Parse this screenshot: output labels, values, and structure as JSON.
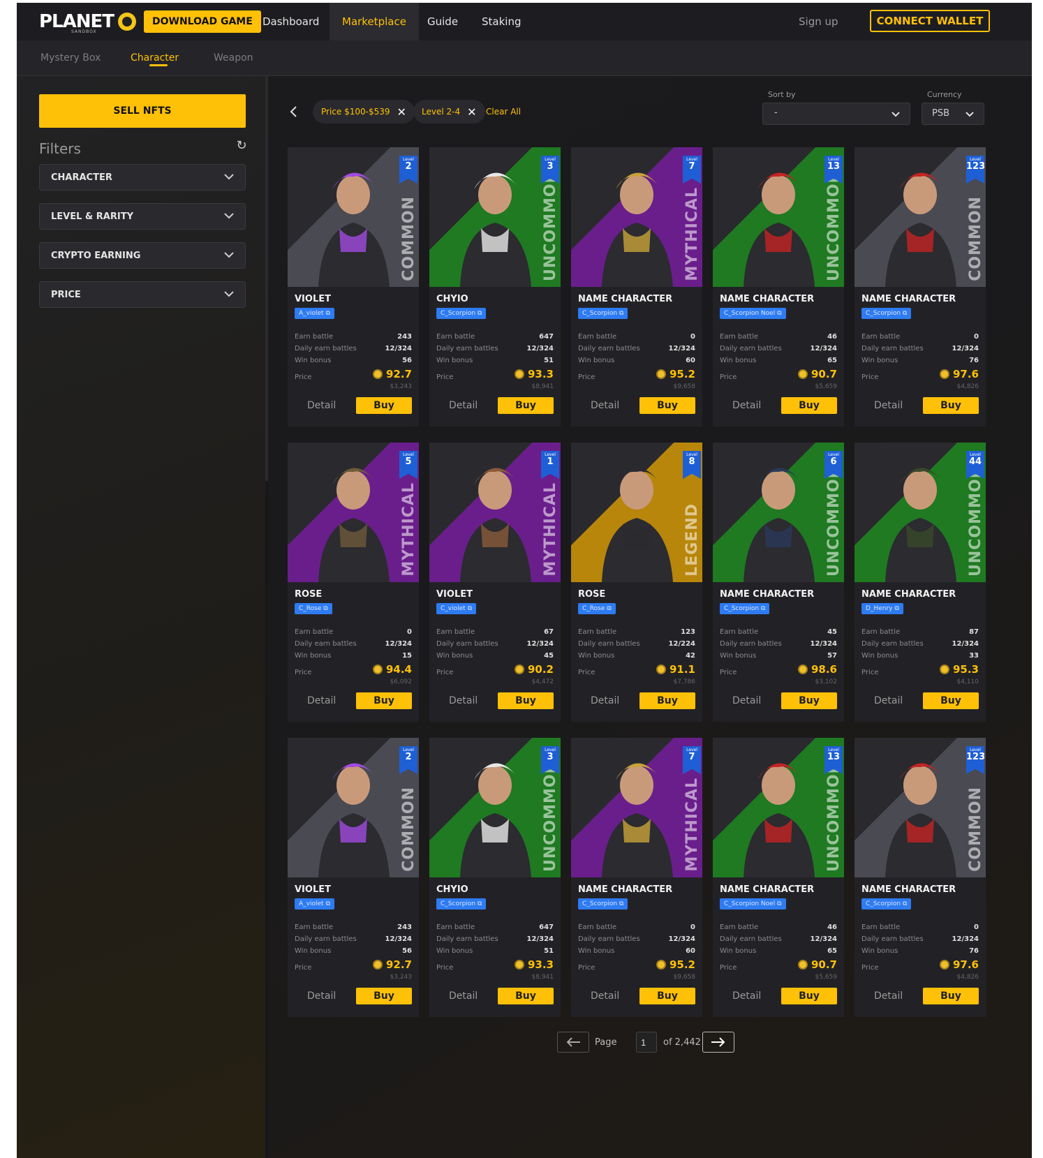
{
  "header": {
    "logo": "PLANET",
    "logo_sub": "SANDBOX",
    "download_label": "DOWNLOAD GAME",
    "nav": [
      "Dashboard",
      "Marketplace",
      "Guide",
      "Staking"
    ],
    "signup_label": "Sign up",
    "connect_label": "CONNECT WALLET"
  },
  "subnav": [
    "Mystery Box",
    "Character",
    "Weapon"
  ],
  "sidebar": {
    "sell_label": "SELL NFTS",
    "filters_title": "Filters",
    "filters": [
      "CHARACTER",
      "LEVEL & RARITY",
      "CRYPTO EARNING",
      "PRICE"
    ]
  },
  "toolbar": {
    "chips": [
      "Price $100-$539",
      "Level 2-4"
    ],
    "clear_all": "Clear All",
    "sort_label": "Sort by",
    "sort_value": "-",
    "currency_label": "Currency",
    "currency_value": "PSB"
  },
  "card_labels": {
    "earn": "Earn battle",
    "daily": "Daily earn battles",
    "win": "Win bonus",
    "price": "Price",
    "detail": "Detail",
    "buy": "Buy",
    "level": "Level"
  },
  "cards": [
    {
      "name": "VIOLET",
      "tag": "A_violet",
      "level": "2",
      "rarity": "COMMON",
      "earn": "243",
      "daily": "12/324",
      "win": "56",
      "price": "92.7",
      "usd": "$3,243",
      "bg": "#4a4a52",
      "accent": "#a14be0"
    },
    {
      "name": "CHYIO",
      "tag": "C_Scorpion",
      "level": "3",
      "rarity": "UNCOMMON",
      "earn": "647",
      "daily": "12/324",
      "win": "51",
      "price": "93.3",
      "usd": "$8,941",
      "bg": "#1f7a22",
      "accent": "#e8e8e8"
    },
    {
      "name": "NAME CHARACTER",
      "tag": "C_Scorpion",
      "level": "7",
      "rarity": "MYTHICAL",
      "earn": "0",
      "daily": "12/324",
      "win": "60",
      "price": "95.2",
      "usd": "$9,658",
      "bg": "#6a1e8c",
      "accent": "#c8a23a"
    },
    {
      "name": "NAME CHARACTER",
      "tag": "C_Scorpion Noel",
      "level": "13",
      "rarity": "UNCOMMON",
      "earn": "46",
      "daily": "12/324",
      "win": "65",
      "price": "90.7",
      "usd": "$5,659",
      "bg": "#1f7a22",
      "accent": "#c42323"
    },
    {
      "name": "NAME CHARACTER",
      "tag": "C_Scorpion",
      "level": "123",
      "rarity": "COMMON",
      "earn": "0",
      "daily": "12/324",
      "win": "76",
      "price": "97.6",
      "usd": "$4,826",
      "bg": "#4a4a52",
      "accent": "#c42323"
    },
    {
      "name": "ROSE",
      "tag": "C_Rose",
      "level": "5",
      "rarity": "MYTHICAL",
      "earn": "0",
      "daily": "12/324",
      "win": "15",
      "price": "94.4",
      "usd": "$6,092",
      "bg": "#6a1e8c",
      "accent": "#6e5a3a"
    },
    {
      "name": "VIOLET",
      "tag": "C_violet",
      "level": "1",
      "rarity": "MYTHICAL",
      "earn": "67",
      "daily": "12/324",
      "win": "45",
      "price": "90.2",
      "usd": "$4,472",
      "bg": "#6a1e8c",
      "accent": "#8a5a3a"
    },
    {
      "name": "ROSE",
      "tag": "C_Rose",
      "level": "8",
      "rarity": "LEGEND",
      "earn": "123",
      "daily": "12/224",
      "win": "42",
      "price": "91.1",
      "usd": "$7,786",
      "bg": "#b8860b",
      "accent": "#2a2a30"
    },
    {
      "name": "NAME CHARACTER",
      "tag": "C_Scorpion",
      "level": "6",
      "rarity": "UNCOMMON",
      "earn": "45",
      "daily": "12/324",
      "win": "57",
      "price": "98.6",
      "usd": "$3,102",
      "bg": "#1f7a22",
      "accent": "#2a3a5a"
    },
    {
      "name": "NAME CHARACTER",
      "tag": "D_Henry",
      "level": "44",
      "rarity": "UNCOMMON",
      "earn": "87",
      "daily": "12/324",
      "win": "33",
      "price": "95.3",
      "usd": "$4,110",
      "bg": "#1f7a22",
      "accent": "#3a4a2a"
    },
    {
      "name": "VIOLET",
      "tag": "A_violet",
      "level": "2",
      "rarity": "COMMON",
      "earn": "243",
      "daily": "12/324",
      "win": "56",
      "price": "92.7",
      "usd": "$3,243",
      "bg": "#4a4a52",
      "accent": "#a14be0"
    },
    {
      "name": "CHYIO",
      "tag": "C_Scorpion",
      "level": "3",
      "rarity": "UNCOMMON",
      "earn": "647",
      "daily": "12/324",
      "win": "51",
      "price": "93.3",
      "usd": "$8,941",
      "bg": "#1f7a22",
      "accent": "#e8e8e8"
    },
    {
      "name": "NAME CHARACTER",
      "tag": "C_Scorpion",
      "level": "7",
      "rarity": "MYTHICAL",
      "earn": "0",
      "daily": "12/324",
      "win": "60",
      "price": "95.2",
      "usd": "$9,658",
      "bg": "#6a1e8c",
      "accent": "#c8a23a"
    },
    {
      "name": "NAME CHARACTER",
      "tag": "C_Scorpion Noel",
      "level": "13",
      "rarity": "UNCOMMON",
      "earn": "46",
      "daily": "12/324",
      "win": "65",
      "price": "90.7",
      "usd": "$5,659",
      "bg": "#1f7a22",
      "accent": "#c42323"
    },
    {
      "name": "NAME CHARACTER",
      "tag": "C_Scorpion",
      "level": "123",
      "rarity": "COMMON",
      "earn": "0",
      "daily": "12/324",
      "win": "76",
      "price": "97.6",
      "usd": "$4,826",
      "bg": "#4a4a52",
      "accent": "#c42323"
    }
  ],
  "pagination": {
    "page_label": "Page",
    "page_value": "1",
    "of_label": "of 2,442"
  },
  "colors": {
    "accent": "#ffc107",
    "tag": "#2e7bf2",
    "level_badge": "#1e5fd6"
  }
}
